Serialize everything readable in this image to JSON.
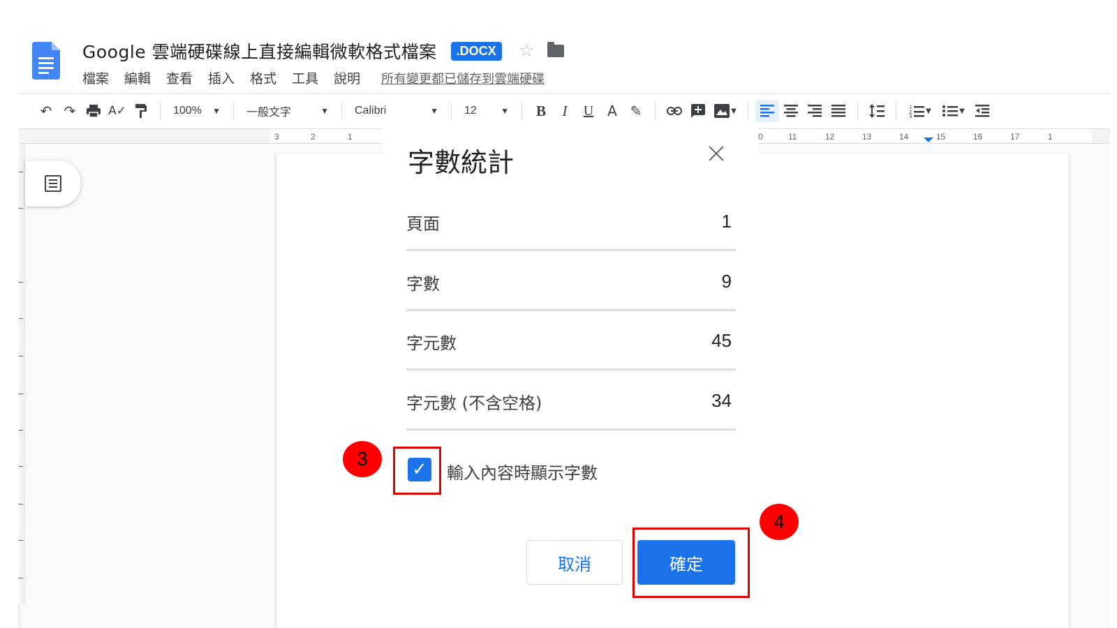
{
  "header": {
    "title": "Google 雲端硬碟線上直接編輯微軟格式檔案",
    "badge": ".DOCX",
    "star_icon": "star-outline-icon",
    "folder_icon": "folder-icon",
    "doc_icon": "google-docs-icon"
  },
  "menu": {
    "items": [
      "檔案",
      "編輯",
      "查看",
      "插入",
      "格式",
      "工具",
      "說明"
    ],
    "save_status": "所有變更都已儲存到雲端硬碟"
  },
  "toolbar": {
    "zoom": "100%",
    "style": "一般文字",
    "font": "Calibri",
    "font_size": "12",
    "bold": "B",
    "italic": "I",
    "underline": "U",
    "text_color": "A"
  },
  "ruler": {
    "left_numbers": [
      "3",
      "2",
      "1"
    ],
    "right_numbers": [
      "0",
      "11",
      "12",
      "13",
      "14",
      "15",
      "16",
      "17",
      "1"
    ]
  },
  "dialog": {
    "title": "字數統計",
    "stats": [
      {
        "label": "頁面",
        "value": "1"
      },
      {
        "label": "字數",
        "value": "9"
      },
      {
        "label": "字元數",
        "value": "45"
      },
      {
        "label": "字元數 (不含空格)",
        "value": "34"
      }
    ],
    "checkbox_label": "輸入內容時顯示字數",
    "checkbox_checked": true,
    "cancel_label": "取消",
    "ok_label": "確定"
  },
  "annotations": {
    "step3": "3",
    "step4": "4",
    "color": "#ff0000"
  },
  "colors": {
    "accent": "#1a73e8",
    "annotation": "#e00000"
  }
}
